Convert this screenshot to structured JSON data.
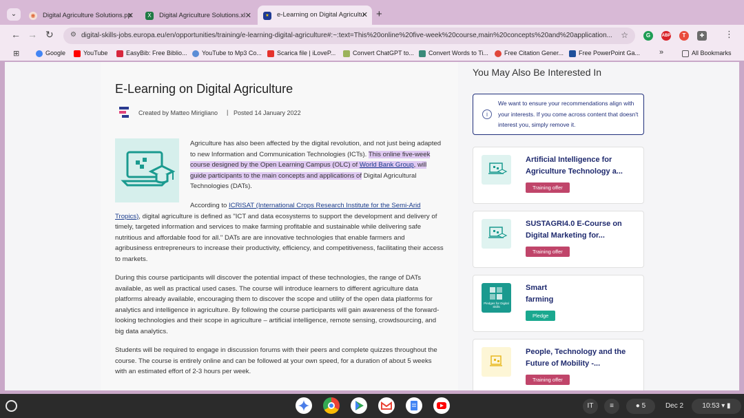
{
  "browser": {
    "tabs": [
      {
        "title": "Digital Agriculture Solutions.pp",
        "icon": "slides-icon",
        "color": "#e06a3a"
      },
      {
        "title": "Digital Agriculture Solutions.xl",
        "icon": "excel-icon",
        "color": "#1f7a45"
      },
      {
        "title": "e-Learning on Digital Agricultu",
        "icon": "eu-flag-icon",
        "color": "#1f3a93"
      }
    ],
    "url": "digital-skills-jobs.europa.eu/en/opportunities/training/e-learning-digital-agriculture#:~:text=This%20online%20five-week%20course,main%20concepts%20and%20application...",
    "bookmarks": [
      "Google",
      "YouTube",
      "EasyBib: Free Biblio...",
      "YouTube to Mp3 Co...",
      "Scarica file | iLoveP...",
      "Convert ChatGPT to...",
      "Convert Words to Ti...",
      "Free Citation Gener...",
      "Free PowerPoint Ga..."
    ],
    "all_bookmarks": "All Bookmarks",
    "more": "»"
  },
  "article": {
    "title": "E-Learning on Digital Agriculture",
    "created_by": "Created by Matteo Mirigliano",
    "separator": "|",
    "posted": "Posted 14 January 2022",
    "p1_before": "Agriculture has also been affected by the digital revolution, and not just being adapted to new Information and Communication Technologies (ICTs). ",
    "p1_hl1": "This online five-week course designed by the Open Learning Campus (OLC) of ",
    "p1_link": "World Bank Group",
    "p1_hl2": ", will guide participants to the main concepts and applications of",
    "p1_after": " Digital Agricultural Technologies (DATs).",
    "p2_before": "According to ",
    "p2_link": "ICRISAT (International Crops Research Institute for the Semi-Arid Tropics)",
    "p2_after": ", digital agriculture is defined as \"ICT and data ecosystems to support the development and delivery of timely, targeted information and services to make farming profitable and sustainable while delivering safe nutritious and affordable food for all.\" DATs are are innovative technologies that enable farmers and agribusiness entrepreneurs to increase their productivity, efficiency, and competitiveness, facilitating their access to markets.",
    "p3": "During this course participants will discover the potential impact of these technologies, the range of DATs available, as well as practical used cases. The course will introduce learners to different agriculture data platforms already available, encouraging them to discover the scope and utility of the open data platforms for analytics and intelligence in agriculture. By following the course participants will gain awareness of the forward-looking technologies and their scope in agriculture – artificial intelligence, remote sensing, crowdsourcing, and big data analytics.",
    "p4": "Students will be required to engage in discussion forums with their peers and complete quizzes throughout the course. The course is entirely online and can be followed at your own speed, for a duration of about 5 weeks with an estimated effort of 2-3 hours per week."
  },
  "sidebar": {
    "title": "You May Also Be Interested In",
    "notice": "We want to ensure your recommendations align with your interests. If you come across content that doesn't interest you, simply remove it.",
    "cards": [
      {
        "title": "Artificial Intelligence for Agriculture Technology a...",
        "badge": "Training offer",
        "badge_color": "#c0456a",
        "thumb_color": "#dff3f0"
      },
      {
        "title": "SUSTAGRI4.0 E-Course on Digital Marketing for...",
        "badge": "Training offer",
        "badge_color": "#c0456a",
        "thumb_color": "#dff3f0"
      },
      {
        "title": "Smart farming",
        "badge": "Pledge",
        "badge_color": "#1aa88f",
        "thumb_color": "#1a9a8f",
        "thumb_text": "Pledges for Digital Skills"
      },
      {
        "title": "People, Technology and the Future of Mobility -...",
        "badge": "Training offer",
        "badge_color": "#c0456a",
        "thumb_color": "#fdf6d6"
      }
    ]
  },
  "shelf": {
    "ime": "IT",
    "date": "Dec 2",
    "time": "10:53",
    "notif_count": "5"
  }
}
